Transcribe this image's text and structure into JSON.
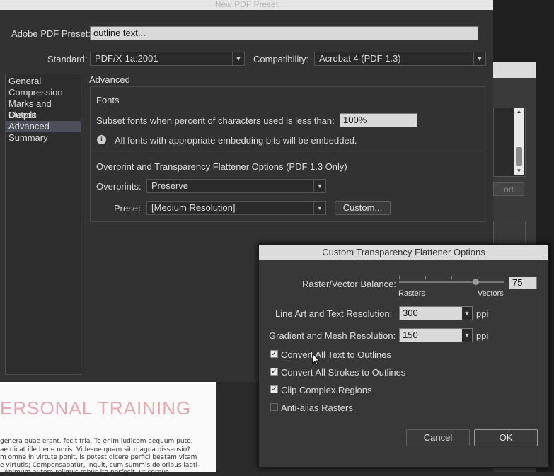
{
  "main_dialog": {
    "title": "New PDF Preset",
    "preset_label": "Adobe PDF Preset:",
    "preset_value": "outline text...",
    "standard_label": "Standard:",
    "standard_value": "PDF/X-1a:2001",
    "compat_label": "Compatibility:",
    "compat_value": "Acrobat 4 (PDF 1.3)",
    "sidebar": [
      "General",
      "Compression",
      "Marks and Bleeds",
      "Output",
      "Advanced",
      "Summary"
    ],
    "section_title": "Advanced",
    "fonts": {
      "title": "Fonts",
      "subset_label": "Subset fonts when percent of characters used is less than:",
      "subset_value": "100%",
      "info": "All fonts with appropriate embedding bits will be embedded."
    },
    "overprint": {
      "title": "Overprint and Transparency Flattener Options (PDF 1.3 Only)",
      "overprints_label": "Overprints:",
      "overprints_value": "Preserve",
      "preset_label": "Preset:",
      "preset_value": "[Medium Resolution]",
      "custom_button": "Custom..."
    }
  },
  "background": {
    "button_partial": "ort...",
    "doc_heading": "ERSONAL TRAINING",
    "doc_lines": [
      "genera quae erant, fecit tria. Te enim iudicem aequum puto,",
      "ae dicat ille bene noris. Videsne quam sit magna dissensio?",
      "m omne in virtute ponit, is potest dicere perfici beatam vitam",
      "e virtutis; Compensabatur, inquit, cum summis doloribus laeti-",
      ". Animum autem reliquis rebus ita perfecit, ut corpus"
    ]
  },
  "flattener": {
    "title": "Custom Transparency Flattener Options",
    "balance_label": "Raster/Vector Balance:",
    "balance_value": "75",
    "rasters_label": "Rasters",
    "vectors_label": "Vectors",
    "line_art_label": "Line Art and Text Resolution:",
    "line_art_value": "300",
    "gradient_label": "Gradient and Mesh Resolution:",
    "gradient_value": "150",
    "unit": "ppi",
    "checkboxes": [
      {
        "label": "Convert All Text to Outlines",
        "checked": true
      },
      {
        "label": "Convert All Strokes to Outlines",
        "checked": true
      },
      {
        "label": "Clip Complex Regions",
        "checked": true
      },
      {
        "label": "Anti-alias Rasters",
        "checked": false
      }
    ],
    "cancel": "Cancel",
    "ok": "OK"
  }
}
